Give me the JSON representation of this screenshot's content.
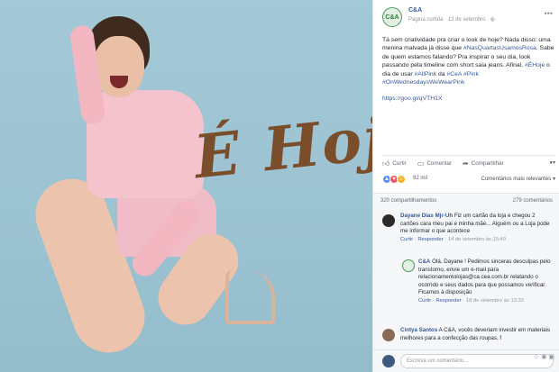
{
  "photo": {
    "overlay_text": "É Hoje",
    "background_color": "#9fc5d4",
    "accent_color": "#7b4e2b"
  },
  "post": {
    "page_name": "C&A",
    "avatar_text": "C&A",
    "meta": "Página curtida · 13 de setembro · ",
    "body_line1": "Tá sem criatividade pra criar o look de hoje? Nada disso: uma menina malvada já disse que ",
    "body_tag1": "#NasQuartasUsamosRosa",
    "body_line2": ". Sabe de quem estamos falando? Pra inspirar o seu dia, look passando pela timeline com short saia jeans. Afinal, ",
    "body_tag2": "#ÉHoje",
    "body_line3": " o dia de usar ",
    "body_tag3": "#AllPink",
    "body_sep1": " da ",
    "body_tag4": "#CeA",
    "body_sep2": " ",
    "body_tag5": "#Pink",
    "body_sep3": " ",
    "body_tag6": "#OnWednesdaysWeWearPink",
    "link": "https://goo.gl/qVTH1X"
  },
  "actions": {
    "like": "Curtir",
    "comment": "Comentar",
    "share": "Compartilhar"
  },
  "reactions": {
    "count": "92 mil",
    "sort": "Comentários mais relevantes ▾"
  },
  "counts": {
    "shares": "320 compartilhamentos",
    "comments": "279 comentários"
  },
  "comments": [
    {
      "name": "Dayane Dias Mjr-Uh",
      "text": " Fiz um cartão da loja e chegou 2 cartões cara meu pai e minha mãe... Alguém ou a Loja pode me informar o que acontece",
      "actions_reply": "Curtir · Responder",
      "time": " · 14 de setembro às 15:40"
    },
    {
      "name": "C&A",
      "text": " Olá, Dayane ! Pedimos sinceras desculpas pelo transtorno, envie um e-mail para relacionamentolojas@ca.cea.com.br relatando o ocorrido e seus dados para que possamos verificar. Ficamos à disposição",
      "actions_reply": "Curtir · Responder",
      "time": " · 18 de setembro às 13:32"
    },
    {
      "name": "Cintya Santos",
      "text": " A C&A, vocês deveriam investir em materiais melhores para a confecção das roupas, f",
      "actions_reply": "",
      "time": ""
    }
  ],
  "comment_box": {
    "placeholder": "Escreva um comentário..."
  }
}
